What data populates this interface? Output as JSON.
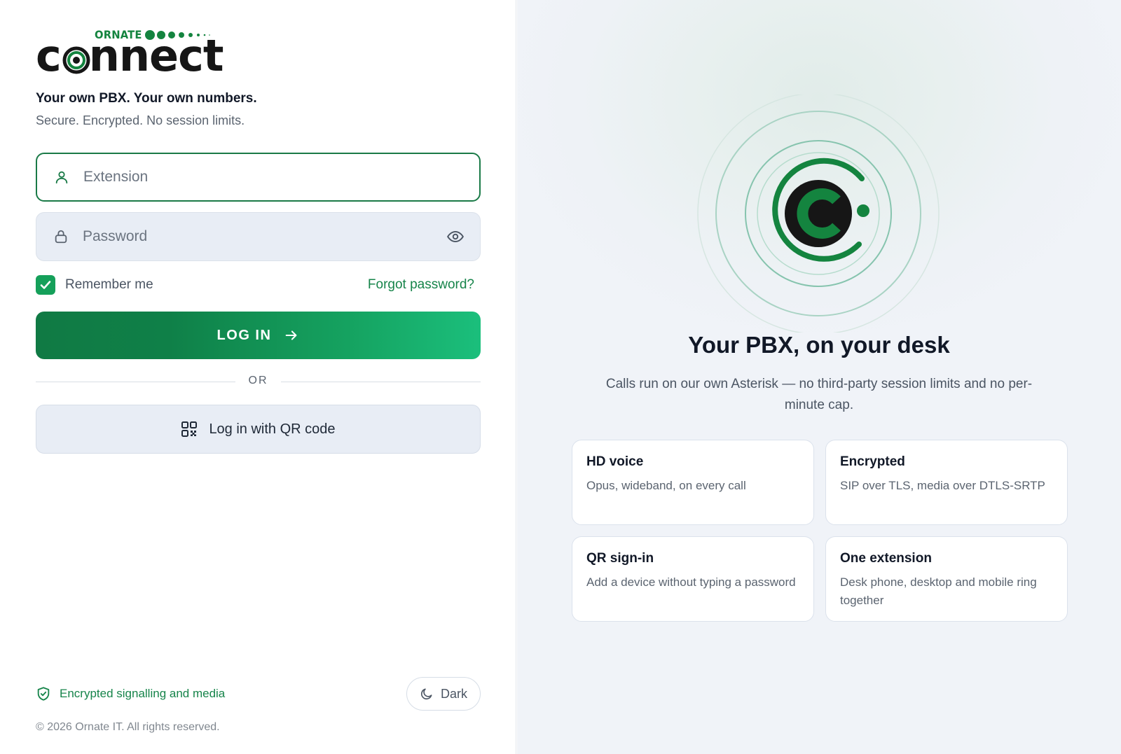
{
  "brand": {
    "small": "ORNATE",
    "word_prefix": "c",
    "word_suffix": "nnect",
    "accent": "#14843f",
    "dark": "#161616"
  },
  "login": {
    "tagline": "Your own PBX. Your own numbers.",
    "subtagline": "Secure. Encrypted. No session limits.",
    "extension_placeholder": "Extension",
    "extension_value": "",
    "password_placeholder": "Password",
    "password_value": "",
    "remember_label": "Remember me",
    "remember_checked": true,
    "forgot_label": "Forgot password?",
    "login_label": "LOG IN",
    "or_label": "OR",
    "qr_label": "Log in with QR code",
    "icons": {
      "extension": "user-icon",
      "password": "lock-icon",
      "show_password": "eye-icon",
      "login": "arrow-right-icon",
      "qr": "qr-code-icon"
    }
  },
  "footer": {
    "secure_label": "Encrypted signalling and media",
    "theme_label": "Dark",
    "copyright": "© 2026 Ornate IT. All rights reserved.",
    "icons": {
      "secure": "shield-check-icon",
      "theme": "moon-icon"
    }
  },
  "hero": {
    "title": "Your PBX, on your desk",
    "subtitle": "Calls run on our own Asterisk — no third-party session limits and no per-minute cap.",
    "features": [
      {
        "title": "HD voice",
        "text": "Opus, wideband, on every call"
      },
      {
        "title": "Encrypted",
        "text": "SIP over TLS, media over DTLS-SRTP"
      },
      {
        "title": "QR sign-in",
        "text": "Add a device without typing a password"
      },
      {
        "title": "One extension",
        "text": "Desk phone, desktop and mobile ring together"
      }
    ]
  },
  "colors": {
    "primary": "#107a44",
    "primary_light": "#1bbf7c",
    "link": "#16844a",
    "input_bg": "#e8edf5"
  }
}
